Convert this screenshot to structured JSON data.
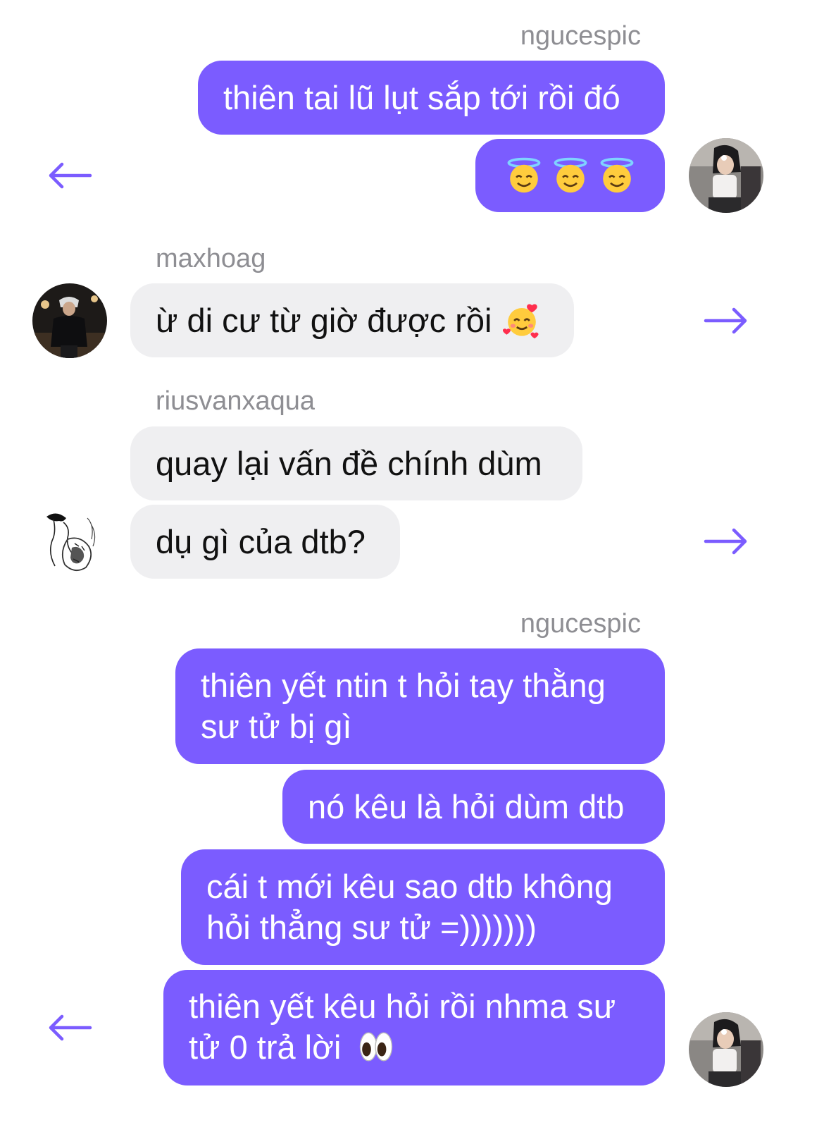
{
  "colors": {
    "outgoing_bubble": "#7b5cff",
    "incoming_bubble": "#efeff1",
    "sender_name": "#8e8e93",
    "arrow": "#7b5cff"
  },
  "groups": [
    {
      "sender": "ngucespic",
      "direction": "outgoing",
      "arrow": "arrow-left-icon",
      "messages": [
        {
          "text": "thiên tai lũ lụt sắp tới rồi đó"
        },
        {
          "text": "",
          "emoji": [
            "smiling-face-with-halo-icon",
            "smiling-face-with-halo-icon",
            "smiling-face-with-halo-icon"
          ]
        }
      ]
    },
    {
      "sender": "maxhoag",
      "direction": "incoming",
      "arrow": "arrow-right-icon",
      "messages": [
        {
          "text": "ừ di cư từ giờ được rồi",
          "emoji": [
            "smiling-face-with-hearts-icon"
          ]
        }
      ]
    },
    {
      "sender": "riusvanxaqua",
      "direction": "incoming",
      "arrow": "arrow-right-icon",
      "messages": [
        {
          "text": "quay lại vấn đề chính dùm"
        },
        {
          "text": "dụ gì của dtb?"
        }
      ]
    },
    {
      "sender": "ngucespic",
      "direction": "outgoing",
      "arrow": "arrow-left-icon",
      "messages": [
        {
          "text": "thiên yết ntin t hỏi tay thằng sư tử bị gì"
        },
        {
          "text": "nó kêu là hỏi dùm dtb"
        },
        {
          "text": "cái t mới kêu sao dtb không hỏi thẳng sư tử =)))))))"
        },
        {
          "text": "thiên yết kêu hỏi rồi nhma sư tử 0 trả lời",
          "emoji": [
            "eyes-icon"
          ]
        }
      ]
    }
  ]
}
